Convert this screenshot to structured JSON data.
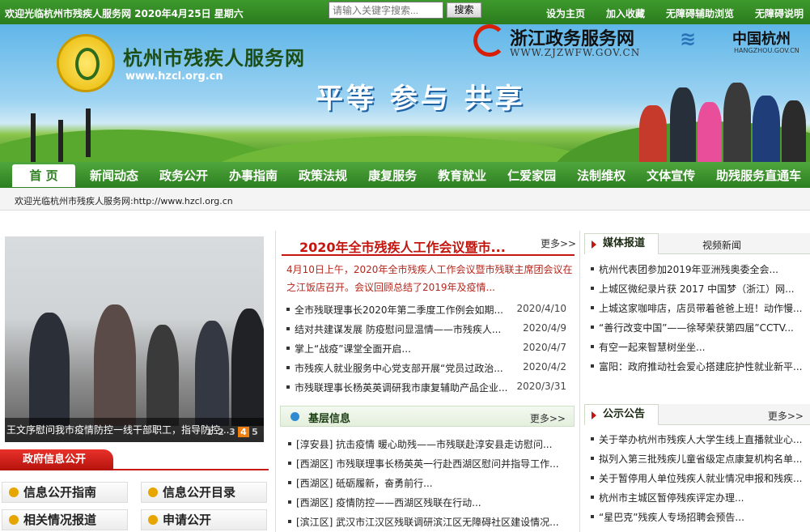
{
  "topbar": {
    "welcome": "欢迎光临杭州市残疾人服务网 2020年4月25日 星期六",
    "search_placeholder": "请输入关键字搜索...",
    "search_button": "搜索",
    "links": [
      "设为主页",
      "加入收藏",
      "无障碍辅助浏览",
      "无障碍说明"
    ]
  },
  "banner": {
    "site_title": "杭州市残疾人服务网",
    "site_url": "www.hzcl.org.cn",
    "slogan": "平等 参与 共享",
    "zj_title": "浙江政务服务网",
    "zj_url": "WWW.ZJZWFW.GOV.CN",
    "hz_title": "中国杭州",
    "hz_url": "HANGZHOU.GOV.CN"
  },
  "nav": {
    "home": "首 页",
    "items": [
      "新闻动态",
      "政务公开",
      "办事指南",
      "政策法规",
      "康复服务",
      "教育就业",
      "仁爱家园",
      "法制维权",
      "文体宣传",
      "助残服务直通车"
    ]
  },
  "marquee": "欢迎光临杭州市残疾人服务网:http://www.hzcl.org.cn",
  "slideshow": {
    "caption": "王文序慰问我市疫情防控一线干部职工，指导防控...",
    "pages": [
      "1",
      "2",
      "3",
      "4",
      "5"
    ],
    "active_page": "4"
  },
  "gov": {
    "heading": "政府信息公开",
    "buttons": [
      "信息公开指南",
      "信息公开目录",
      "相关情况报道",
      "申请公开"
    ]
  },
  "lead": {
    "title": "2020年全市残疾人工作会议暨市...",
    "more": "更多>>",
    "summary": "4月10日上午，2020年全市残疾人工作会议暨市残联主席团会议在之江饭店召开。会议回顾总结了2019年及疫情..."
  },
  "news": [
    {
      "title": "全市残联理事长2020年第二季度工作例会如期...",
      "date": "2020/4/10"
    },
    {
      "title": "结对共建谋发展 防疫慰问显温情——市残疾人...",
      "date": "2020/4/9"
    },
    {
      "title": "掌上“战疫”课堂全面开启...",
      "date": "2020/4/7"
    },
    {
      "title": "市残疾人就业服务中心党支部开展“党员过政治...",
      "date": "2020/4/2"
    },
    {
      "title": "市残联理事长杨英英调研我市康复辅助产品企业...",
      "date": "2020/3/31"
    }
  ],
  "grassroots": {
    "heading": "基层信息",
    "more": "更多>>",
    "items": [
      "[淳安县] 抗击疫情 暖心助残——市残联赴淳安县走访慰问...",
      "[西湖区] 市残联理事长杨英英一行赴西湖区慰问并指导工作...",
      "[西湖区] 砥砺履新，奋勇前行...",
      "[西湖区] 疫情防控——西湖区残联在行动...",
      "[滨江区] 武汉市江汉区残联调研滨江区无障碍社区建设情况..."
    ]
  },
  "media": {
    "tab": "媒体报道",
    "tab2": "视频新闻",
    "items": [
      "杭州代表团参加2019年亚洲残奥委全会...",
      "上城区微纪录片获 2017 中国梦（浙江）网...",
      "上城这家咖啡店，店员带着爸爸上班！动作慢...",
      "“善行改变中国”——徐琴荣获第四届”CCTV...",
      "有空一起来智慧树坐坐...",
      "富阳：政府推动社会爱心搭建庇护性就业新平..."
    ]
  },
  "notice": {
    "tab": "公示公告",
    "more": "更多>>",
    "items": [
      "关于举办杭州市残疾人大学生线上直播就业心...",
      "拟列入第三批残疾儿童省级定点康复机构名单...",
      "关于暂停用人单位残疾人就业情况申报和残疾...",
      "杭州市主城区暂停残疾评定办理...",
      "“星巴克”残疾人专场招聘会预告..."
    ]
  },
  "colors": {
    "nav_green": "#2d7f1f",
    "accent_red": "#c4160e"
  }
}
